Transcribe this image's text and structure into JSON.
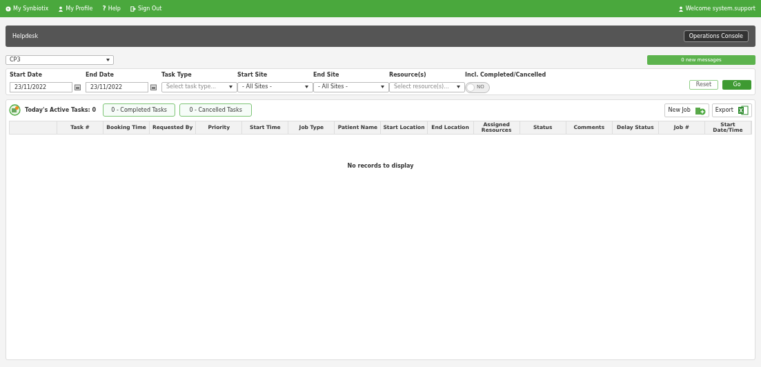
{
  "top_nav": {
    "links": [
      {
        "kind": "globe",
        "label": "My Synbiotix"
      },
      {
        "kind": "user",
        "label": "My Profile"
      },
      {
        "kind": "help",
        "label": "Help",
        "icon_text": "?"
      },
      {
        "kind": "signout",
        "label": "Sign Out"
      }
    ],
    "welcome": "Welcome system.support"
  },
  "header": {
    "title": "Helpdesk",
    "console_button": "Operations Console"
  },
  "site_select": {
    "value": "CP3"
  },
  "messages": "0 new messages",
  "filters": [
    {
      "kind": "date",
      "label": "Start Date",
      "value": "23/11/2022"
    },
    {
      "kind": "date",
      "label": "End Date",
      "value": "23/11/2022"
    },
    {
      "kind": "select",
      "label": "Task Type",
      "placeholder": "Select task type..."
    },
    {
      "kind": "select",
      "label": "Start Site",
      "value": "- All Sites -"
    },
    {
      "kind": "select",
      "label": "End Site",
      "value": "- All Sites -"
    },
    {
      "kind": "select",
      "label": "Resource(s)",
      "placeholder": "Select resource(s)..."
    },
    {
      "kind": "toggle",
      "label": "Incl. Completed/Cancelled",
      "on": false,
      "text": "NO"
    }
  ],
  "filter_buttons": {
    "reset": "Reset",
    "go": "Go"
  },
  "tasks": {
    "active": "Today's Active Tasks: 0",
    "completed": "0 - Completed Tasks",
    "cancelled": "0 - Cancelled Tasks",
    "new_job": "New Job",
    "export": "Export"
  },
  "table": {
    "columns": [
      "Task #",
      "Booking Time",
      "Requested By",
      "Priority",
      "Start Time",
      "Job Type",
      "Patient Name",
      "Start Location",
      "End Location",
      "Assigned Resources",
      "Status",
      "Comments",
      "Delay Status",
      "Job #",
      "Start Date/Time"
    ],
    "empty": "No records to display"
  }
}
